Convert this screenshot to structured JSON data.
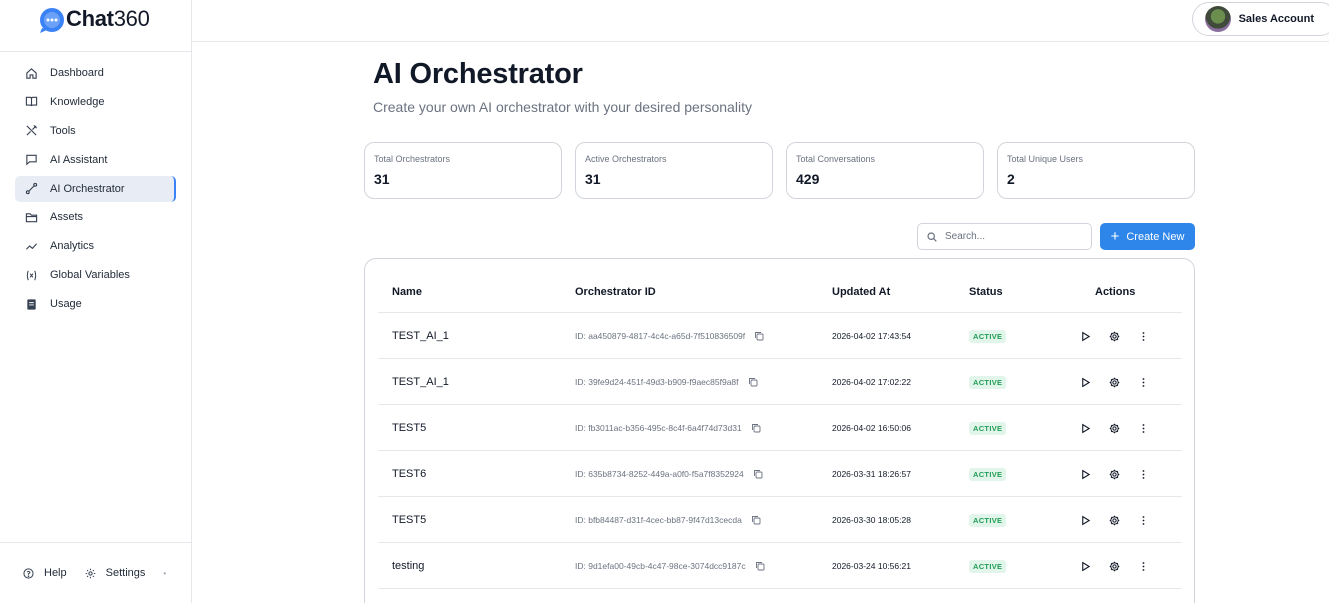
{
  "brand": {
    "name_part1": "Chat",
    "name_part2": "360"
  },
  "account": {
    "name": "Sales Account"
  },
  "sidebar": {
    "items": [
      {
        "label": "Dashboard",
        "icon": "home-icon",
        "active": false
      },
      {
        "label": "Knowledge",
        "icon": "book-icon",
        "active": false
      },
      {
        "label": "Tools",
        "icon": "tools-icon",
        "active": false
      },
      {
        "label": "AI Assistant",
        "icon": "chat-icon",
        "active": false
      },
      {
        "label": "AI Orchestrator",
        "icon": "orchestrator-icon",
        "active": true
      },
      {
        "label": "Assets",
        "icon": "folder-icon",
        "active": false
      },
      {
        "label": "Analytics",
        "icon": "trend-icon",
        "active": false
      },
      {
        "label": "Global Variables",
        "icon": "variable-icon",
        "active": false
      },
      {
        "label": "Usage",
        "icon": "document-icon",
        "active": false
      }
    ],
    "footer": {
      "help": "Help",
      "settings": "Settings"
    }
  },
  "page": {
    "title": "AI Orchestrator",
    "subtitle": "Create your own AI orchestrator with your desired personality"
  },
  "stats": [
    {
      "label": "Total Orchestrators",
      "value": "31"
    },
    {
      "label": "Active Orchestrators",
      "value": "31"
    },
    {
      "label": "Total Conversations",
      "value": "429"
    },
    {
      "label": "Total Unique Users",
      "value": "2"
    }
  ],
  "search": {
    "placeholder": "Search..."
  },
  "create_button": {
    "label": "Create New"
  },
  "table": {
    "headers": {
      "name": "Name",
      "id": "Orchestrator ID",
      "updated": "Updated At",
      "status": "Status",
      "actions": "Actions"
    },
    "rows": [
      {
        "name": "TEST_AI_1",
        "id": "ID: aa450879-4817-4c4c-a65d-7f510836509f",
        "updated": "2026-04-02 17:43:54",
        "status": "ACTIVE"
      },
      {
        "name": "TEST_AI_1",
        "id": "ID: 39fe9d24-451f-49d3-b909-f9aec85f9a8f",
        "updated": "2026-04-02 17:02:22",
        "status": "ACTIVE"
      },
      {
        "name": "TEST5",
        "id": "ID: fb3011ac-b356-495c-8c4f-6a4f74d73d31",
        "updated": "2026-04-02 16:50:06",
        "status": "ACTIVE"
      },
      {
        "name": "TEST6",
        "id": "ID: 635b8734-8252-449a-a0f0-f5a7f8352924",
        "updated": "2026-03-31 18:26:57",
        "status": "ACTIVE"
      },
      {
        "name": "TEST5",
        "id": "ID: bfb84487-d31f-4cec-bb87-9f47d13cecda",
        "updated": "2026-03-30 18:05:28",
        "status": "ACTIVE"
      },
      {
        "name": "testing",
        "id": "ID: 9d1efa00-49cb-4c47-98ce-3074dcc9187c",
        "updated": "2026-03-24 10:56:21",
        "status": "ACTIVE"
      }
    ]
  },
  "colors": {
    "accent": "#2f86ea",
    "active_badge_bg": "#e2f5ea",
    "active_badge_text": "#1f9d55",
    "active_nav_bg": "#e8edf5"
  }
}
